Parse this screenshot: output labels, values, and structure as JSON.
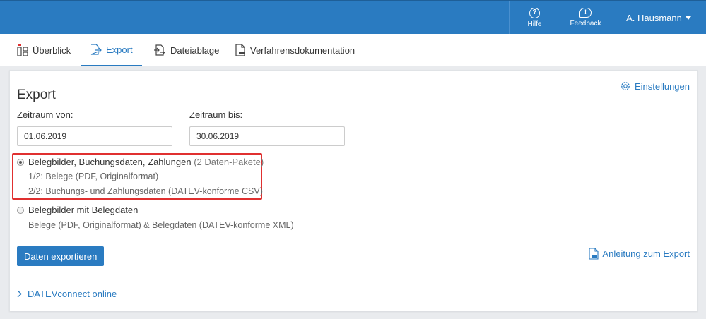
{
  "topbar": {
    "help_label": "Hilfe",
    "feedback_label": "Feedback",
    "user_name": "A. Hausmann"
  },
  "tabs": [
    {
      "label": "Überblick",
      "icon": "overview-icon",
      "active": false
    },
    {
      "label": "Export",
      "icon": "export-icon",
      "active": true
    },
    {
      "label": "Dateiablage",
      "icon": "file-storage-icon",
      "active": false
    },
    {
      "label": "Verfahrensdokumentation",
      "icon": "document-icon",
      "active": false
    }
  ],
  "export": {
    "title": "Export",
    "settings_label": "Einstellungen",
    "from_label": "Zeitraum von:",
    "from_value": "01.06.2019",
    "to_label": "Zeitraum bis:",
    "to_value": "30.06.2019",
    "option1": {
      "label": "Belegbilder, Buchungsdaten, Zahlungen",
      "note": "(2 Daten-Pakete)",
      "line1": "1/2: Belege (PDF, Originalformat)",
      "line2": "2/2: Buchungs- und Zahlungsdaten (DATEV-konforme CSV)",
      "selected": true
    },
    "option2": {
      "label": "Belegbilder mit Belegdaten",
      "line1": "Belege (PDF, Originalformat) & Belegdaten (DATEV-konforme XML)",
      "selected": false
    },
    "export_button": "Daten exportieren",
    "guide_link": "Anleitung zum Export",
    "connect_link": "DATEVconnect online"
  },
  "colors": {
    "primary": "#2a7bc1",
    "highlight": "#e03030"
  }
}
